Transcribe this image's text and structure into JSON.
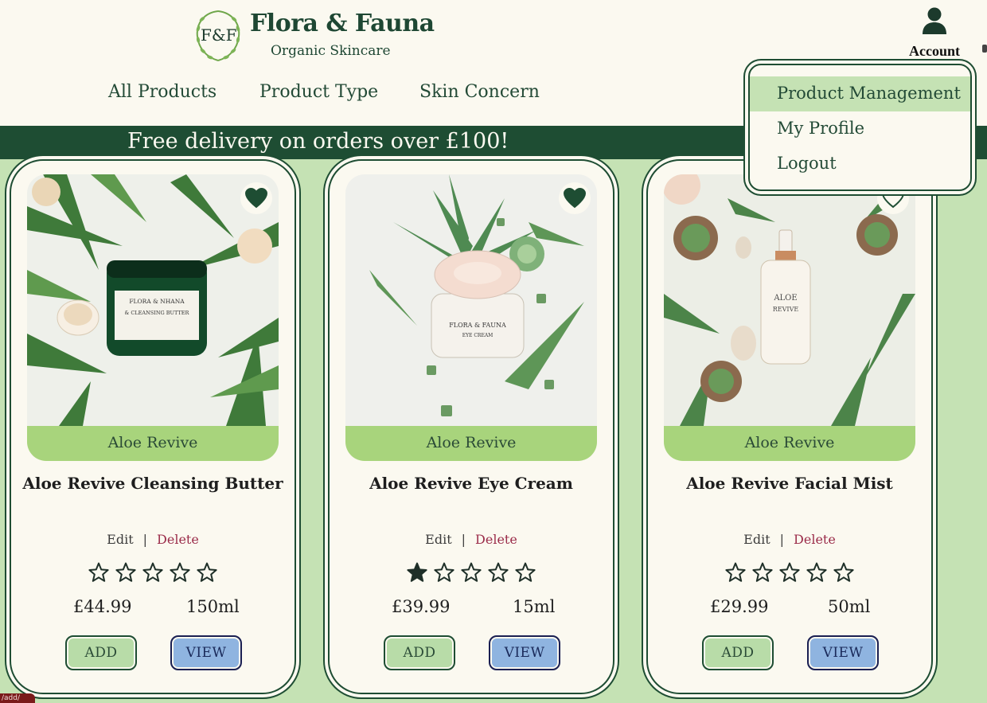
{
  "brand": {
    "monogram": "F&F",
    "name": "Flora & Fauna",
    "tagline": "Organic Skincare"
  },
  "nav": {
    "items": [
      {
        "label": "All Products"
      },
      {
        "label": "Product Type"
      },
      {
        "label": "Skin Concern"
      }
    ]
  },
  "account": {
    "label": "Account",
    "menu": [
      {
        "label": "Product Management",
        "active": true
      },
      {
        "label": "My Profile",
        "active": false
      },
      {
        "label": "Logout",
        "active": false
      }
    ]
  },
  "banner": {
    "text": "Free delivery on orders over £100!"
  },
  "products": [
    {
      "brand": "Aloe Revive",
      "name": "Aloe Revive Cleansing Butter",
      "edit_label": "Edit",
      "separator": "|",
      "delete_label": "Delete",
      "rating": 0,
      "rating_max": 5,
      "price": "£44.99",
      "size": "150ml",
      "add_label": "ADD",
      "view_label": "VIEW",
      "favourited": true,
      "jar_label_line1": "FLORA & NHANA",
      "jar_label_line2": "& CLEANSING BUTTER"
    },
    {
      "brand": "Aloe Revive",
      "name": "Aloe Revive Eye Cream",
      "edit_label": "Edit",
      "separator": "|",
      "delete_label": "Delete",
      "rating": 1,
      "rating_max": 5,
      "price": "£39.99",
      "size": "15ml",
      "add_label": "ADD",
      "view_label": "VIEW",
      "favourited": true,
      "jar_label_line1": "FLORA & FAUNA",
      "jar_label_line2": "EYE CREAM"
    },
    {
      "brand": "Aloe Revive",
      "name": "Aloe Revive Facial Mist",
      "edit_label": "Edit",
      "separator": "|",
      "delete_label": "Delete",
      "rating": 0,
      "rating_max": 5,
      "price": "£29.99",
      "size": "50ml",
      "add_label": "ADD",
      "view_label": "VIEW",
      "favourited": false,
      "bottle_label_line1": "ALOE",
      "bottle_label_line2": "REVIVE"
    }
  ],
  "status_url": "/add/",
  "colors": {
    "page_bg": "#c5e2b4",
    "header_bg": "#fbf9f0",
    "banner_bg": "#1e4d33",
    "brand_strip": "#a8d47c",
    "delete_text": "#9b2c4a",
    "view_button": "#8fb4e0",
    "add_button": "#b8dca8"
  },
  "icons": {
    "account": "user-icon",
    "favourite": "heart-icon",
    "rating": "star-icon"
  }
}
